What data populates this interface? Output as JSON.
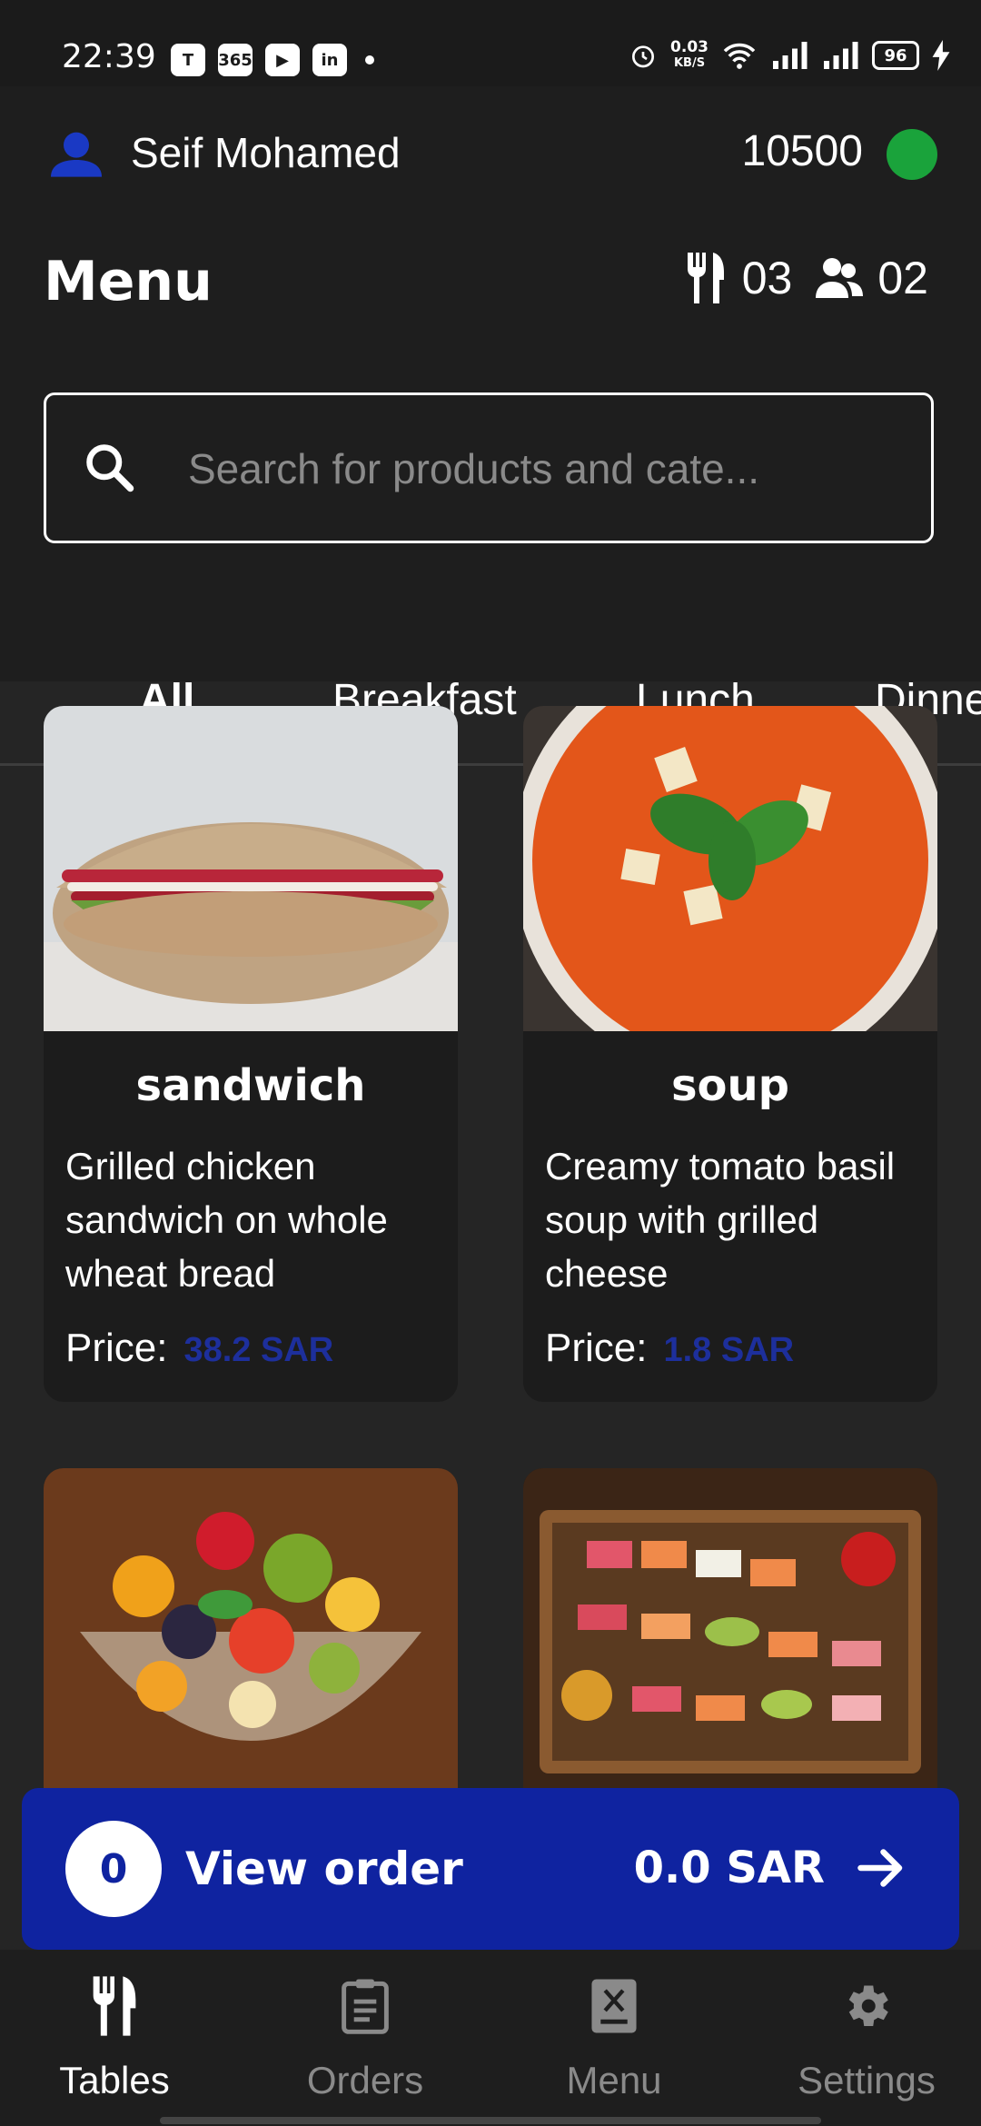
{
  "status_bar": {
    "time": "22:39",
    "apps": [
      "T",
      "365",
      "▶",
      "in"
    ],
    "net_speed": "0.03",
    "net_unit": "KB/S",
    "battery": "96"
  },
  "header": {
    "user_name": "Seif Mohamed",
    "balance": "10500",
    "status_color": "#1aa33b"
  },
  "page": {
    "title": "Menu",
    "tables_count": "03",
    "guests_count": "02"
  },
  "search": {
    "placeholder": "Search for products and cate..."
  },
  "tabs": [
    {
      "label": "All",
      "active": true
    },
    {
      "label": "Breakfast",
      "active": false
    },
    {
      "label": "Lunch",
      "active": false
    },
    {
      "label": "Dinne",
      "active": false
    }
  ],
  "products": [
    {
      "name": "sandwich",
      "description": "Grilled chicken sandwich on whole wheat bread",
      "price_label": "Price:",
      "price": "38.2 SAR",
      "image": "sandwich-image"
    },
    {
      "name": "soup",
      "description": "Creamy tomato basil soup with grilled cheese",
      "price_label": "Price:",
      "price": "1.8 SAR",
      "image": "tomato-soup-image"
    },
    {
      "image": "fruit-salad-image"
    },
    {
      "image": "sushi-platter-image"
    }
  ],
  "order_bar": {
    "count": "0",
    "label": "View order",
    "total": "0.0 SAR",
    "arrow_icon": "arrow-right-icon"
  },
  "bottom_nav": [
    {
      "label": "Tables",
      "icon": "cutlery-icon",
      "active": true
    },
    {
      "label": "Orders",
      "icon": "clipboard-icon",
      "active": false
    },
    {
      "label": "Menu",
      "icon": "menu-book-icon",
      "active": false
    },
    {
      "label": "Settings",
      "icon": "gear-icon",
      "active": false
    }
  ],
  "colors": {
    "accent": "#0f23a0",
    "tab_indicator": "#1a39c4",
    "price": "#1d2f9c",
    "background": "#252525"
  }
}
